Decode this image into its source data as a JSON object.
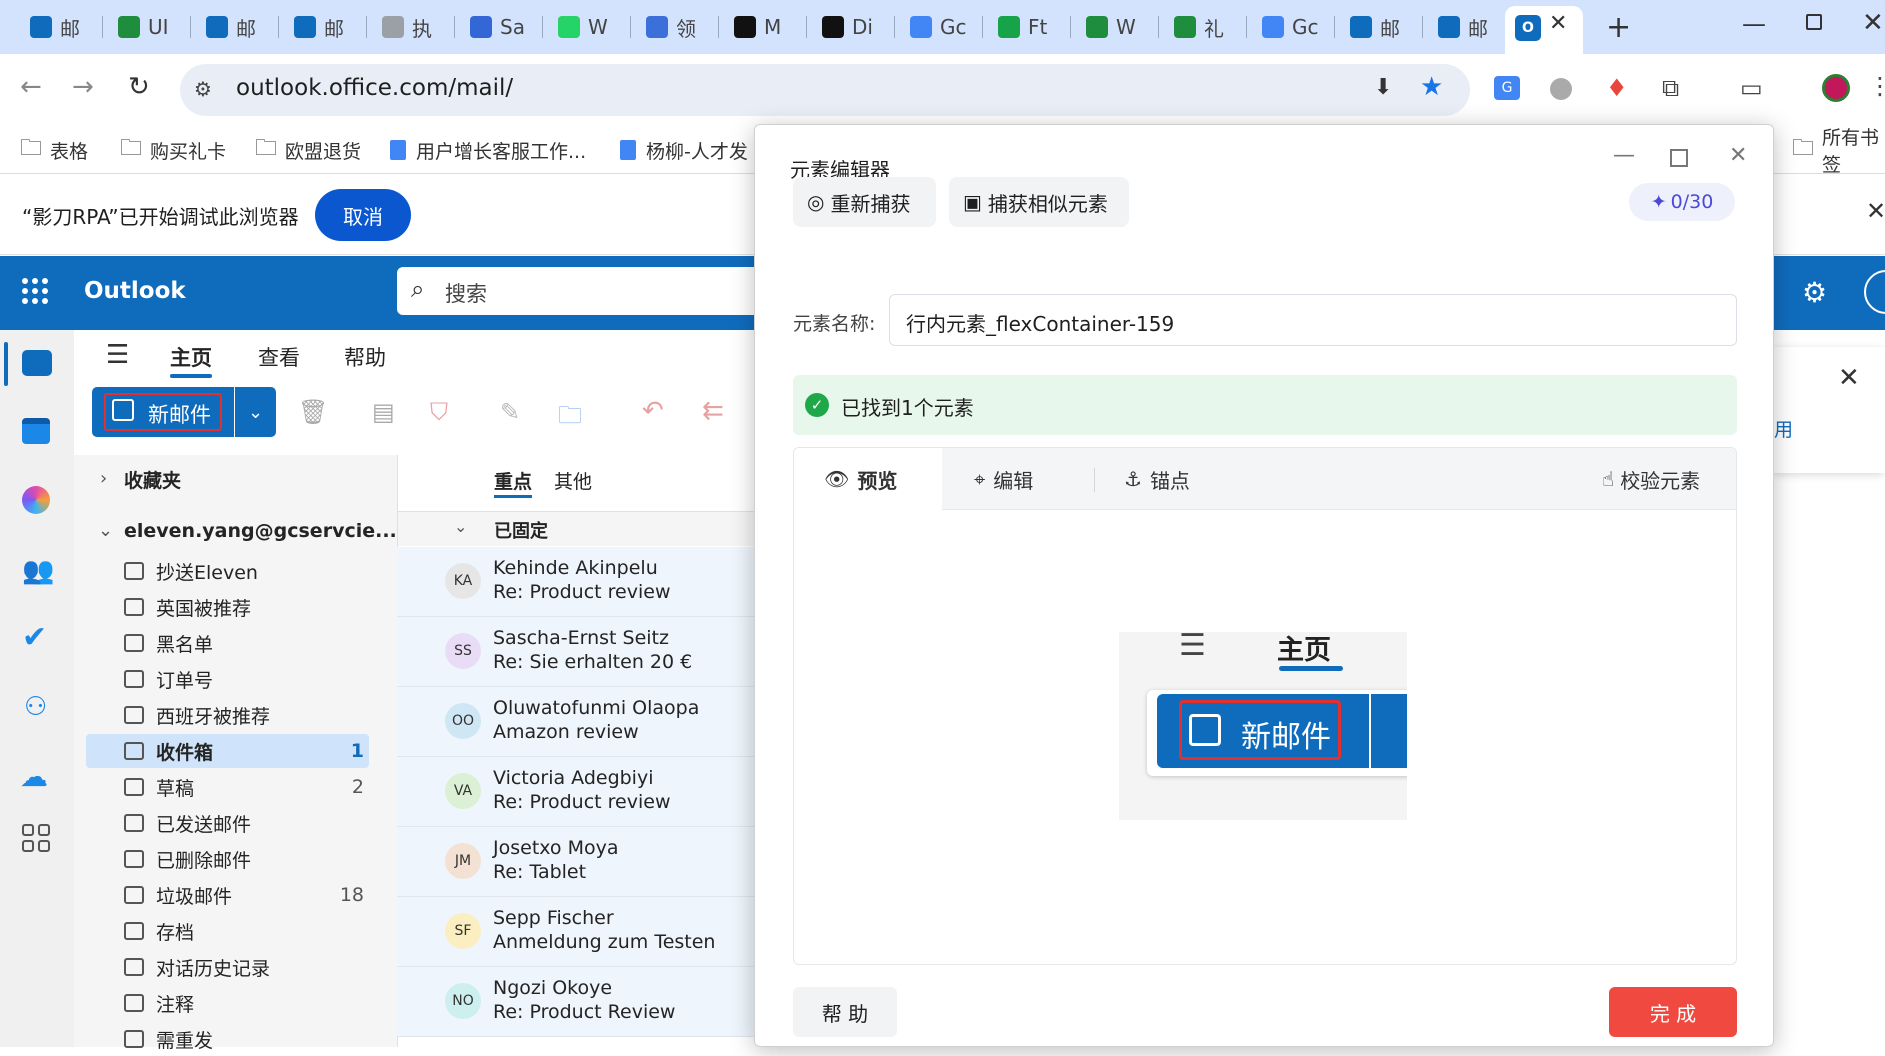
{
  "browser": {
    "tabs": [
      {
        "label": "邮",
        "color": "#0f6cbd",
        "icon": "outlook-icon"
      },
      {
        "label": "UI",
        "color": "#1e8e3e",
        "icon": "plus-square-icon"
      },
      {
        "label": "邮",
        "color": "#0f6cbd",
        "icon": "outlook-icon"
      },
      {
        "label": "邮",
        "color": "#0f6cbd",
        "icon": "outlook-icon"
      },
      {
        "label": "执",
        "color": "#9aa0a6",
        "icon": "doc-icon"
      },
      {
        "label": "Sa",
        "color": "#3367d6",
        "icon": "chat-icon"
      },
      {
        "label": "W",
        "color": "#25d366",
        "icon": "whatsapp-icon"
      },
      {
        "label": "领",
        "color": "#3b6fd9",
        "icon": "a-logo-icon"
      },
      {
        "label": "M",
        "color": "#111111",
        "icon": "amazon-icon"
      },
      {
        "label": "Di",
        "color": "#111111",
        "icon": "amazon-icon"
      },
      {
        "label": "Gc",
        "color": "#4285f4",
        "icon": "translate-icon"
      },
      {
        "label": "Ft",
        "color": "#16a34a",
        "icon": "grid-circle-icon"
      },
      {
        "label": "W",
        "color": "#1e8e3e",
        "icon": "sheet-icon"
      },
      {
        "label": "礼",
        "color": "#1e8e3e",
        "icon": "sheet-icon"
      },
      {
        "label": "Gc",
        "color": "#4285f4",
        "icon": "translate-icon"
      },
      {
        "label": "邮",
        "color": "#0f6cbd",
        "icon": "outlook-icon"
      },
      {
        "label": "邮",
        "color": "#0f6cbd",
        "icon": "outlook-icon"
      }
    ],
    "url": "outlook.office.com/mail/",
    "bookmarks": [
      "表格",
      "购买礼卡",
      "欧盟退货",
      "用户增长客服工作...",
      "杨柳-人才发",
      "所有书签"
    ],
    "infobar_text": "“影刀RPA”已开始调试此浏览器",
    "infobar_cancel": "取消"
  },
  "outlook": {
    "app_name": "Outlook",
    "search_placeholder": "搜索",
    "ribbon_tabs": [
      "主页",
      "查看",
      "帮助"
    ],
    "new_mail": "新邮件",
    "favorites": "收藏夹",
    "account": "eleven.yang@gcservcie...",
    "folders": [
      {
        "name": "抄送Eleven",
        "count": ""
      },
      {
        "name": "英国被推荐",
        "count": ""
      },
      {
        "name": "黑名单",
        "count": ""
      },
      {
        "name": "订单号",
        "count": ""
      },
      {
        "name": "西班牙被推荐",
        "count": ""
      },
      {
        "name": "收件箱",
        "count": "1"
      },
      {
        "name": "草稿",
        "count": "2"
      },
      {
        "name": "已发送邮件",
        "count": ""
      },
      {
        "name": "已删除邮件",
        "count": ""
      },
      {
        "name": "垃圾邮件",
        "count": "18"
      },
      {
        "name": "存档",
        "count": ""
      },
      {
        "name": "对话历史记录",
        "count": ""
      },
      {
        "name": "注释",
        "count": ""
      },
      {
        "name": "需重发",
        "count": ""
      }
    ],
    "list_tabs": [
      "重点",
      "其他"
    ],
    "pinned_header": "已固定",
    "messages": [
      {
        "initials": "KA",
        "sender": "Kehinde Akinpelu",
        "subject": "Re: Product review",
        "color": "#e6e6e6"
      },
      {
        "initials": "SS",
        "sender": "Sascha-Ernst Seitz",
        "subject": "Re: Sie erhalten 20 €",
        "color": "#e9dcf7"
      },
      {
        "initials": "OO",
        "sender": "Oluwatofunmi Olaopa",
        "subject": "Amazon review",
        "color": "#cfe6f5"
      },
      {
        "initials": "VA",
        "sender": "Victoria Adegbiyi",
        "subject": "Re: Product review",
        "color": "#dbf0d4"
      },
      {
        "initials": "JM",
        "sender": "Josetxo Moya",
        "subject": "Re: Tablet",
        "color": "#f3e2d3"
      },
      {
        "initials": "SF",
        "sender": "Sepp Fischer",
        "subject": "Anmeldung zum Testen",
        "color": "#fbeec0"
      },
      {
        "initials": "NO",
        "sender": "Ngozi Okoye",
        "subject": "Re: Product Review",
        "color": "#cdeff0"
      }
    ],
    "right_link": "用"
  },
  "dialog": {
    "title": "元素编辑器",
    "recapture": "重新捕获",
    "capture_similar": "捕获相似元素",
    "ai_count": "0/30",
    "name_label": "元素名称:",
    "name_value": "行内元素_flexContainer-159",
    "found_text": "已找到1个元素",
    "tabs": {
      "preview": "预览",
      "edit": "编辑",
      "anchor": "锚点",
      "validate": "校验元素"
    },
    "preview": {
      "tab_label": "主页",
      "button_label": "新邮件"
    },
    "help": "帮 助",
    "done": "完 成"
  }
}
